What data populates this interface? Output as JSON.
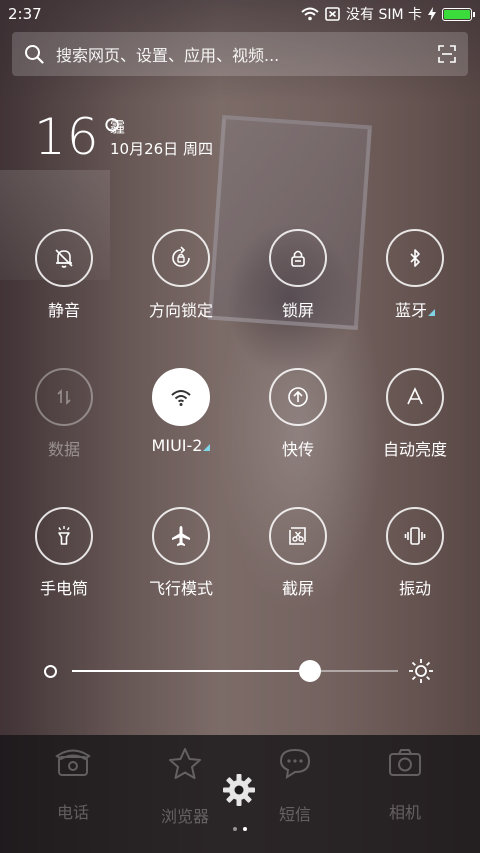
{
  "status": {
    "time": "2:37",
    "sim": "没有 SIM 卡",
    "battery": 1.0
  },
  "search": {
    "placeholder": "搜索网页、设置、应用、视频..."
  },
  "weather": {
    "temp": "16°",
    "condition": "霾",
    "date": "10月26日 周四"
  },
  "toggles": [
    {
      "label": "静音",
      "icon": "bell-off-icon"
    },
    {
      "label": "方向锁定",
      "icon": "rotation-lock-icon"
    },
    {
      "label": "锁屏",
      "icon": "lock-icon"
    },
    {
      "label": "蓝牙",
      "icon": "bluetooth-icon"
    },
    {
      "label": "数据",
      "icon": "mobile-data-icon"
    },
    {
      "label": "MIUI-2",
      "icon": "wifi-icon"
    },
    {
      "label": "快传",
      "icon": "upload-icon"
    },
    {
      "label": "自动亮度",
      "icon": "auto-brightness-icon"
    },
    {
      "label": "手电筒",
      "icon": "flashlight-icon"
    },
    {
      "label": "飞行模式",
      "icon": "airplane-icon"
    },
    {
      "label": "截屏",
      "icon": "screenshot-icon"
    },
    {
      "label": "振动",
      "icon": "vibrate-icon"
    }
  ],
  "brightness": {
    "level": 0.73
  },
  "dock": {
    "items": [
      {
        "label": "电话",
        "icon": "phone-icon"
      },
      {
        "label": "浏览器",
        "icon": "star-icon"
      },
      {
        "label": "短信",
        "icon": "message-icon"
      },
      {
        "label": "相机",
        "icon": "camera-icon"
      }
    ]
  },
  "colors": {
    "battery": "#3bdb3b",
    "accent_triangle": "#7fd4e6"
  }
}
